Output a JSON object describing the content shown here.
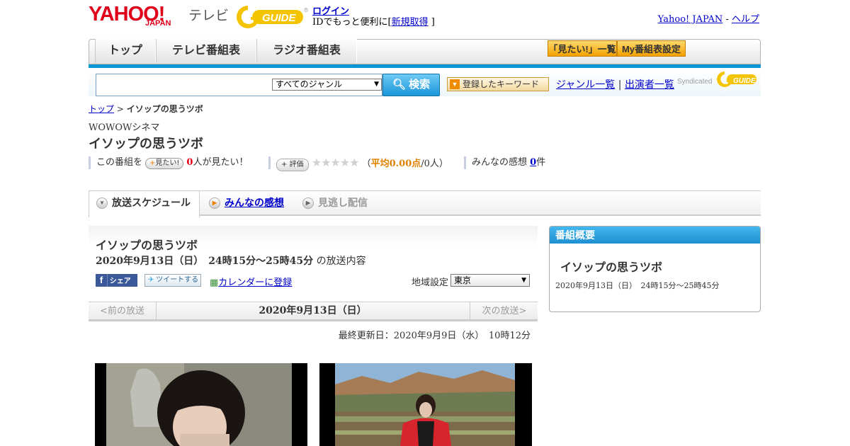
{
  "header": {
    "logo_yahoo": "YAHOO!",
    "logo_japan": "JAPAN",
    "logo_tv": "テレビ",
    "gguide_logo": "G-GUIDE",
    "login_label": "ログイン",
    "login_sub_prefix": "IDでもっと便利に[",
    "signup_label": "新規取得",
    "login_sub_suffix": "]",
    "yahoo_japan_link": "Yahoo! JAPAN",
    "separator": "-",
    "help_link": "ヘルプ"
  },
  "nav": {
    "tabs": [
      {
        "label": "トップ"
      },
      {
        "label": "テレビ番組表"
      },
      {
        "label": "ラジオ番組表"
      }
    ],
    "mitai_list": "「見たい!」一覧",
    "my_schedule": "My番組表設定"
  },
  "search": {
    "genre_selected": "すべてのジャンル",
    "search_button": "検索",
    "keyword_button": "登録したキーワード",
    "genre_list_link": "ジャンル一覧",
    "link_separator": "|",
    "cast_list_link": "出演者一覧",
    "syndicated": "Syndicated",
    "gguide_small": "G-GUIDE"
  },
  "breadcrumb": {
    "top": "トップ",
    "sep": ">",
    "current": "イソップの思うツボ"
  },
  "program": {
    "channel": "WOWOWシネマ",
    "title": "イソップの思うツボ",
    "mitai_prefix": "この番組を",
    "mitai_button": "見たい!",
    "mitai_count": "0",
    "mitai_suffix": "人が見たい！",
    "rating_button": "評価",
    "stars": "★★★★★",
    "avg_open": "（",
    "avg_label": "平均0.00点",
    "avg_count": "/0人）",
    "impressions_label": "みんなの感想",
    "impressions_count": "0",
    "impressions_unit": "件"
  },
  "content_tabs": {
    "schedule": "放送スケジュール",
    "impressions": "みんなの感想",
    "missed": "見逃し配信"
  },
  "detail": {
    "title": "イソップの思うツボ",
    "date": "2020年9月13日（日）　24時15分～25時45分",
    "date_suffix": "の放送内容",
    "fb_share": "シェア",
    "tweet": "ツイートする",
    "calendar": "カレンダーに登録",
    "region_label": "地域設定",
    "region_selected": "東京",
    "prev": "<前の放送",
    "current_date": "2020年9月13日（日）",
    "next": "次の放送>",
    "updated": "最終更新日：2020年9月9日（水）　10時12分"
  },
  "side_box": {
    "heading": "番組概要",
    "title": "イソップの思うツボ",
    "date": "2020年9月13日（日）　24時15分～25時45分"
  },
  "colors": {
    "yahoo_red": "#e0001a",
    "accent_blue": "#0b96d6",
    "link": "#0000cc",
    "orange": "#f3a100"
  }
}
